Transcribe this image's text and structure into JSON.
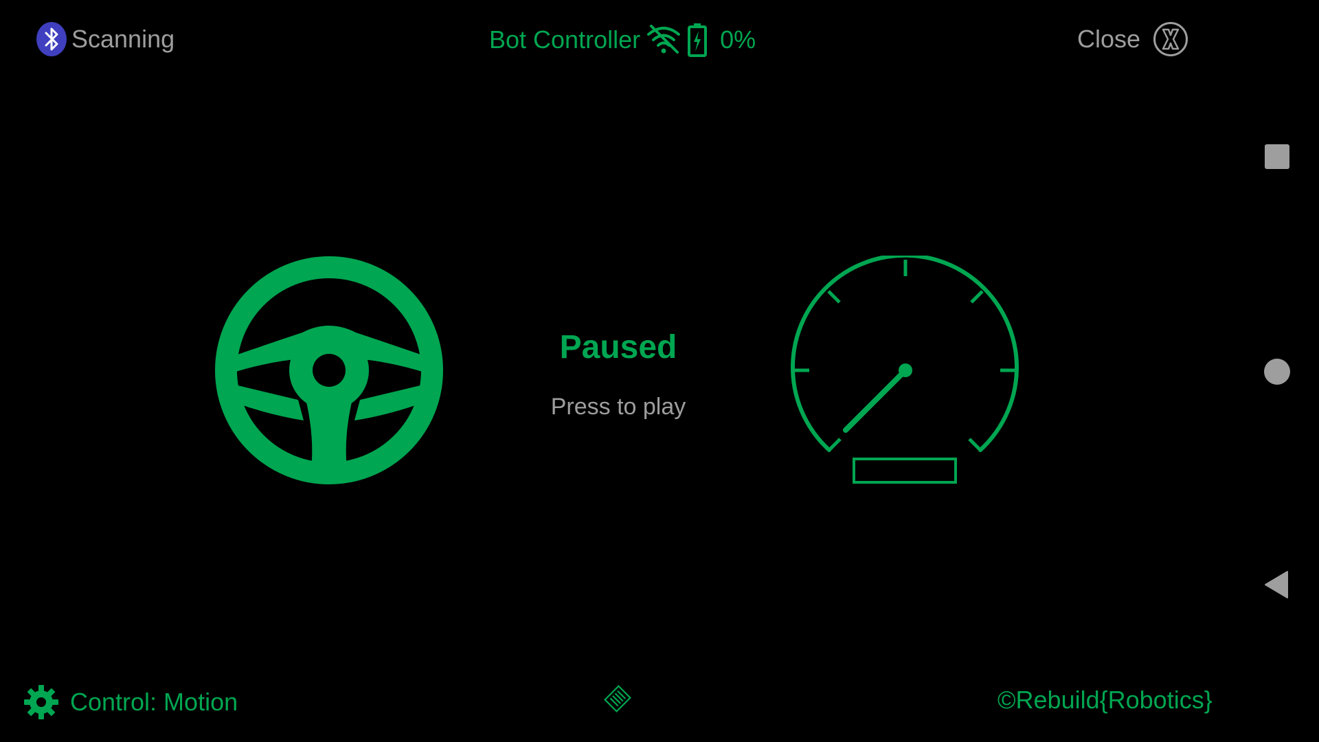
{
  "top_bar": {
    "bluetooth": {
      "icon": "bluetooth-icon",
      "label": "Scanning",
      "icon_color": "#3f3fbf"
    },
    "title": "Bot Controller",
    "wifi_icon": "wifi-off-icon",
    "battery_icon": "battery-charging-icon",
    "battery_percent": "0%",
    "close": {
      "label": "Close",
      "icon": "close-icon"
    }
  },
  "main": {
    "steering_icon": "steering-wheel-icon",
    "speedometer_icon": "speedometer-icon",
    "state": "Paused",
    "hint": "Press to play"
  },
  "nav_bar": {
    "recents_icon": "square-icon",
    "home_icon": "circle-icon",
    "back_icon": "back-triangle-icon"
  },
  "bottom_bar": {
    "settings_icon": "gear-icon",
    "control_label": "Control: Motion",
    "center_icon": "chip-icon",
    "copyright": "©Rebuild{Robotics}"
  },
  "colors": {
    "accent": "#00a651",
    "muted_text": "#9e9e9e",
    "background": "#000000"
  }
}
